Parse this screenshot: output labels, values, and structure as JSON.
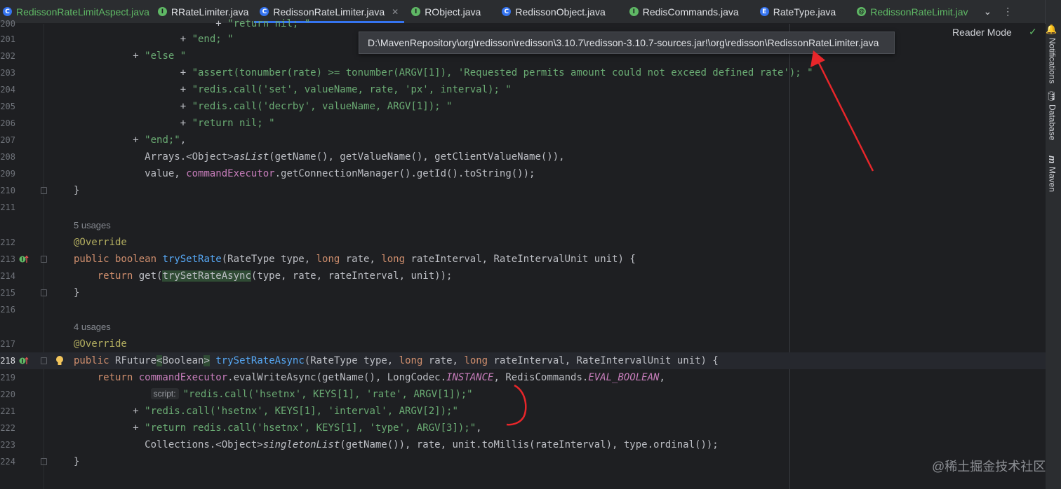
{
  "tabs": [
    {
      "label": "RedissonRateLimitAspect.java",
      "icon_letter": "C",
      "icon_color": "#3574f0",
      "label_color": "green",
      "close": false
    },
    {
      "label": "RRateLimiter.java",
      "icon_letter": "I",
      "icon_color": "#5fb865",
      "label_color": "normal",
      "close": true
    },
    {
      "label": "RedissonRateLimiter.java",
      "icon_letter": "C",
      "icon_color": "#3574f0",
      "label_color": "normal",
      "close": true,
      "active": true
    },
    {
      "label": "RObject.java",
      "icon_letter": "I",
      "icon_color": "#5fb865",
      "label_color": "normal",
      "close": true
    },
    {
      "label": "RedissonObject.java",
      "icon_letter": "C",
      "icon_color": "#3574f0",
      "label_color": "normal",
      "close": true
    },
    {
      "label": "RedisCommands.java",
      "icon_letter": "I",
      "icon_color": "#5fb865",
      "label_color": "normal",
      "close": true
    },
    {
      "label": "RateType.java",
      "icon_letter": "E",
      "icon_color": "#3574f0",
      "label_color": "normal",
      "close": true
    },
    {
      "label": "RedissonRateLimit.jav",
      "icon_letter": "@",
      "icon_color": "#5fb865",
      "label_color": "green",
      "close": false
    }
  ],
  "tab_overflow_icon": "chevron-down-icon",
  "tab_menu_icon": "more-vertical-icon",
  "tool_window_strip": [
    {
      "label": "Notifications",
      "icon": "bell-icon"
    },
    {
      "label": "Database",
      "icon": "database-icon"
    },
    {
      "label": "Maven",
      "icon": "maven-icon"
    }
  ],
  "reader_mode": "Reader Mode",
  "tooltip_path": "D:\\MavenRepository\\org\\redisson\\redisson\\3.10.7\\redisson-3.10.7-sources.jar!\\org\\redisson\\RedissonRateLimiter.java",
  "line_numbers": [
    "200",
    "201",
    "202",
    "203",
    "204",
    "205",
    "206",
    "207",
    "208",
    "209",
    "210",
    "211",
    "",
    "212",
    "213",
    "214",
    "215",
    "216",
    "",
    "217",
    "218",
    "219",
    "220",
    "221",
    "222",
    "223",
    "224",
    ""
  ],
  "usages": {
    "first": "5 usages",
    "second": "4 usages"
  },
  "inlay_script": "script:",
  "watermark": "@稀土掘金技术社区",
  "colors": {
    "keyword": "#cf8e6d",
    "string": "#6aab73",
    "annotation": "#b3ae60",
    "method": "#56a8f5",
    "field": "#c77dbb",
    "background": "#1e1f22",
    "accent": "#3574f0"
  }
}
